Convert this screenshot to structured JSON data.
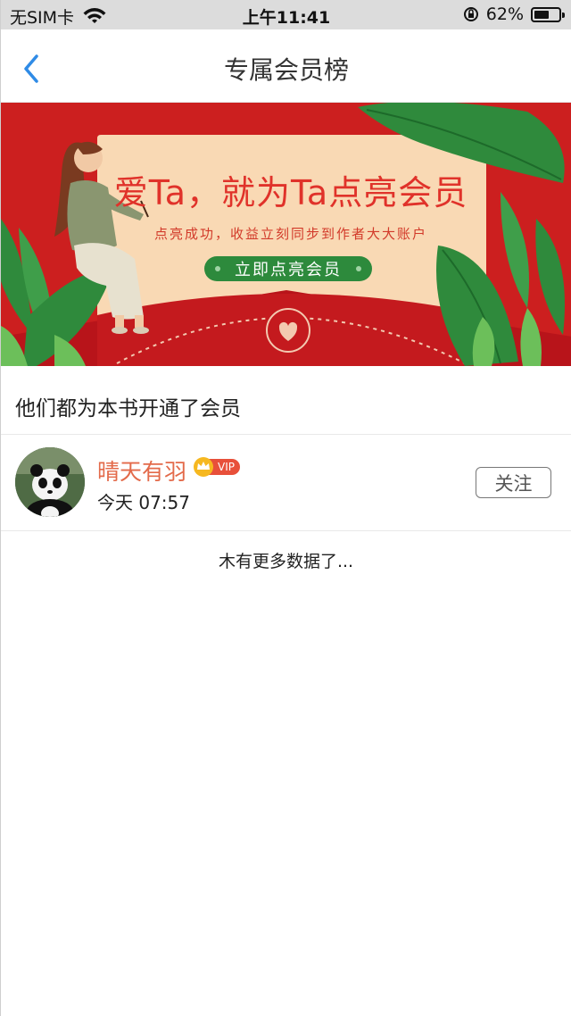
{
  "status_bar": {
    "carrier": "无SIM卡",
    "time": "上午11:41",
    "battery_percent": "62%",
    "battery_level": 0.62,
    "icons": [
      "wifi-icon",
      "orientation-lock-icon",
      "battery-icon"
    ]
  },
  "nav": {
    "title": "专属会员榜",
    "back_icon": "chevron-left-icon",
    "accent_color": "#2f8be6"
  },
  "banner": {
    "title": "爱Ta，就为Ta点亮会员",
    "subtitle": "点亮成功，收益立刻同步到作者大大账户",
    "cta_label": "立即点亮会员",
    "colors": {
      "background": "#cc1f1f",
      "card": "#f9d9b4",
      "button": "#2d8a3c",
      "title": "#e0322a"
    }
  },
  "section": {
    "title": "他们都为本书开通了会员"
  },
  "members": [
    {
      "name": "晴天有羽",
      "badge": "VIP",
      "time": "今天 07:57",
      "follow_label": "关注",
      "name_color": "#e36a4a"
    }
  ],
  "footer": {
    "no_more_text": "木有更多数据了..."
  }
}
